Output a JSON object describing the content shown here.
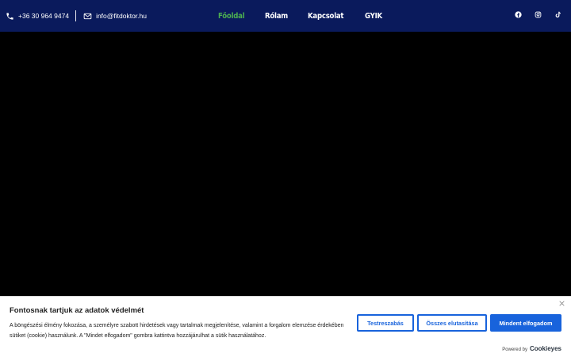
{
  "header": {
    "phone": "+36 30 964 9474",
    "email": "info@fitdoktor.hu",
    "nav": [
      {
        "label": "Főoldal"
      },
      {
        "label": "Rólam"
      },
      {
        "label": "Kapcsolat"
      },
      {
        "label": "GYIK"
      }
    ],
    "social": [
      "facebook-icon",
      "instagram-icon",
      "tiktok-icon"
    ],
    "colors": {
      "background": "#0a1a5c",
      "active_nav": "#4caf50"
    }
  },
  "cookie": {
    "title": "Fontosnak tartjuk az adatok védelmét",
    "text": "A böngészési élmény fokozása, a személyre szabott hirdetések vagy tartalmak megjelenítése, valamint a forgalom elemzése érdekében sütiket (cookie) használunk. A \"Mindet elfogadom\" gombra kattintva hozzájárulhat a sütik használatához.",
    "buttons": {
      "customize": "Testreszabás",
      "reject": "Összes elutasítása",
      "accept": "Mindent elfogadom"
    },
    "powered_by": "Powered by",
    "powered_brand": "Cookieyes",
    "colors": {
      "accent": "#1863dc"
    }
  }
}
